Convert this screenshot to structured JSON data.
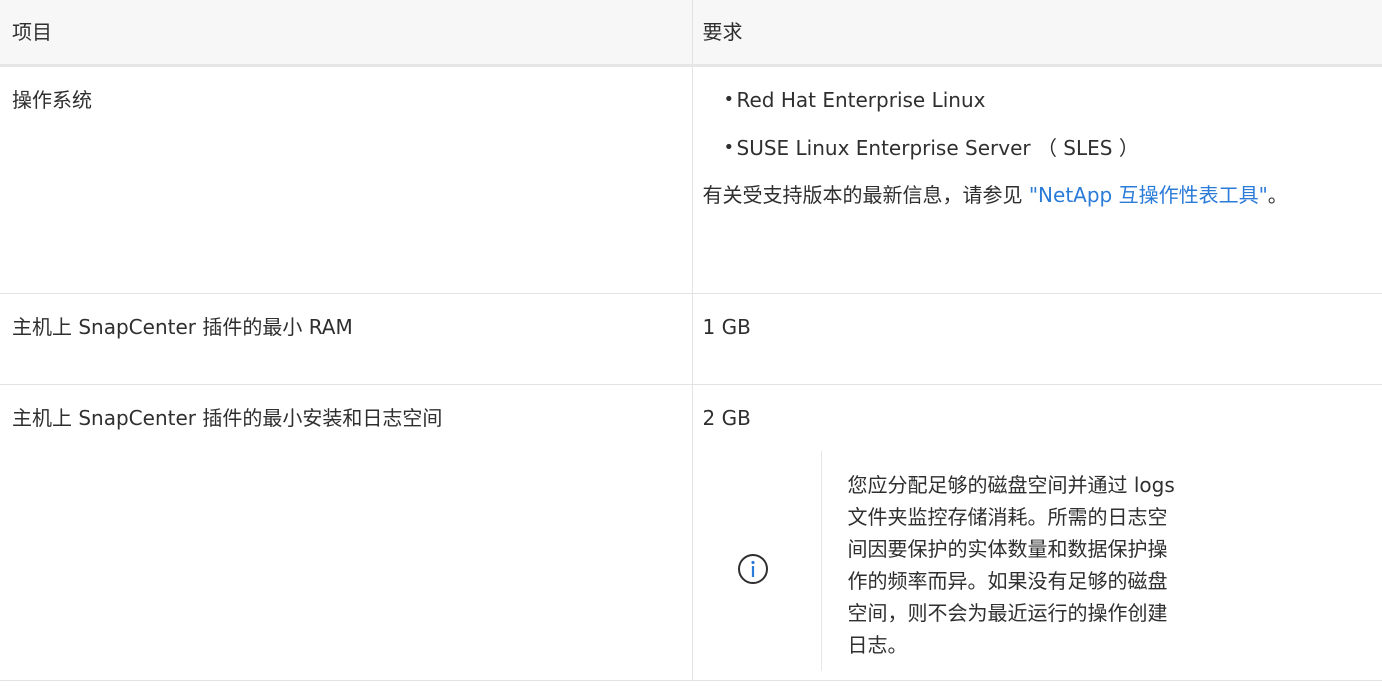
{
  "table": {
    "headers": {
      "item": "项目",
      "requirement": "要求"
    },
    "rows": {
      "os": {
        "item": "操作系统",
        "bullets": [
          "Red Hat Enterprise Linux",
          "SUSE Linux Enterprise Server （ SLES ）"
        ],
        "note_prefix": "有关受支持版本的最新信息，请参见 ",
        "note_link": "\"NetApp 互操作性表工具\"",
        "note_suffix": "。"
      },
      "ram": {
        "item": "主机上 SnapCenter 插件的最小 RAM",
        "value": "1 GB"
      },
      "space": {
        "item": "主机上 SnapCenter 插件的最小安装和日志空间",
        "value": "2 GB",
        "note_icon": "info-circle-icon",
        "note": "您应分配足够的磁盘空间并通过 logs 文件夹监控存储消耗。所需的日志空间因要保护的实体数量和数据保护操作的频率而异。如果没有足够的磁盘空间，则不会为最近运行的操作创建日志。"
      }
    }
  },
  "colors": {
    "text": "#2f2f2f",
    "link": "#2b7bd8",
    "border": "#e3e3e3",
    "header_bg": "#f7f7f7"
  }
}
